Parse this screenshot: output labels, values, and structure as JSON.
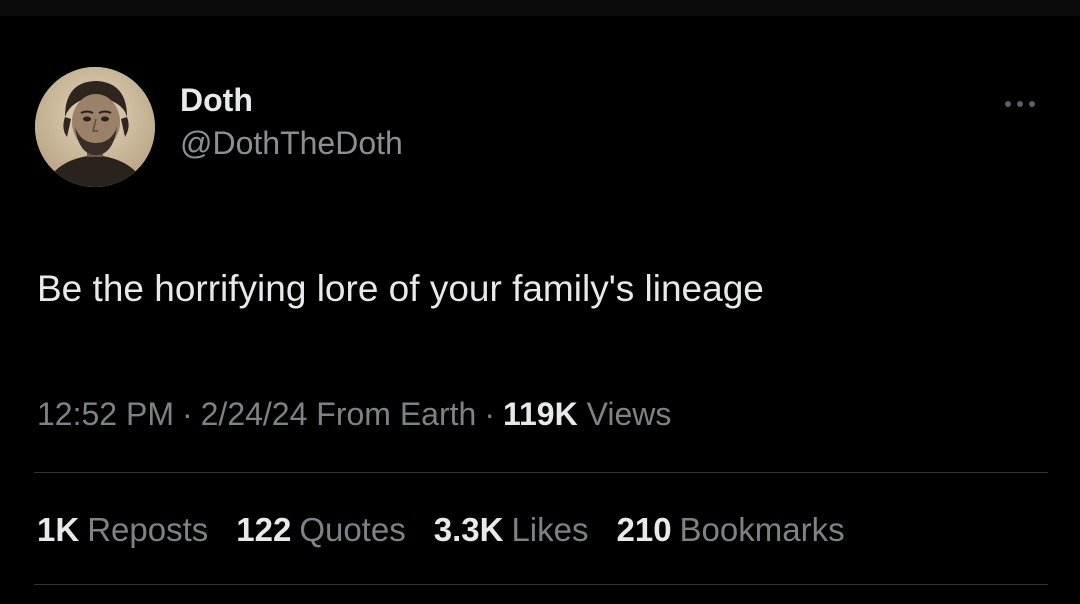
{
  "author": {
    "display_name": "Doth",
    "handle": "@DothTheDoth"
  },
  "tweet": {
    "text": "Be the horrifying lore of your family's lineage"
  },
  "meta": {
    "time": "12:52 PM",
    "separator": "·",
    "date": "2/24/24",
    "location": "From Earth",
    "views_count": "119K",
    "views_label": "Views"
  },
  "stats": [
    {
      "count": "1K",
      "label": "Reposts"
    },
    {
      "count": "122",
      "label": "Quotes"
    },
    {
      "count": "3.3K",
      "label": "Likes"
    },
    {
      "count": "210",
      "label": "Bookmarks"
    }
  ],
  "icons": {
    "more": "more-horizontal-icon",
    "avatar": "profile-photo-portrait"
  },
  "colors": {
    "background": "#000000",
    "primary_text": "#e7e9ea",
    "secondary_text": "#7d8286",
    "divider": "#2f3336"
  }
}
